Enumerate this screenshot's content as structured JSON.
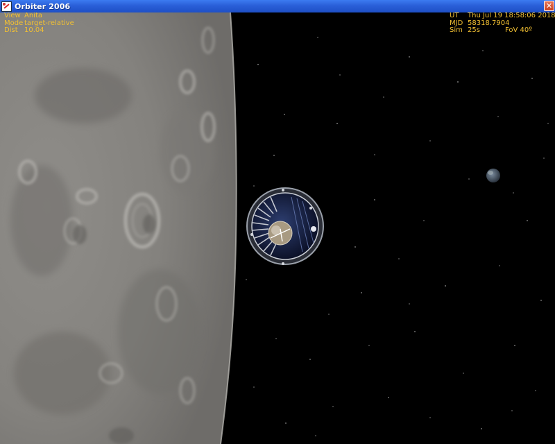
{
  "window": {
    "title": "Orbiter 2006",
    "close_glyph": "✕",
    "app_icon": "orbiter-app-icon"
  },
  "hud_left": {
    "view_label": "View",
    "view_value": "Anita",
    "mode_label": "Mode",
    "mode_value": "target-relative",
    "dist_label": "Dist",
    "dist_value": "10.04"
  },
  "hud_right": {
    "ut_label": "UT",
    "ut_value": "Thu Jul 19 18:58:06 2018",
    "mjd_label": "MJD",
    "mjd_value": "58318.7904",
    "sim_label": "Sim",
    "sim_value": "25s",
    "fov_label": "FoV",
    "fov_value": "40º"
  },
  "colors": {
    "hud_text": "#f2c032",
    "titlebar": "#2a5fd8",
    "space": "#000000",
    "moon_surface": "#8a8884"
  }
}
